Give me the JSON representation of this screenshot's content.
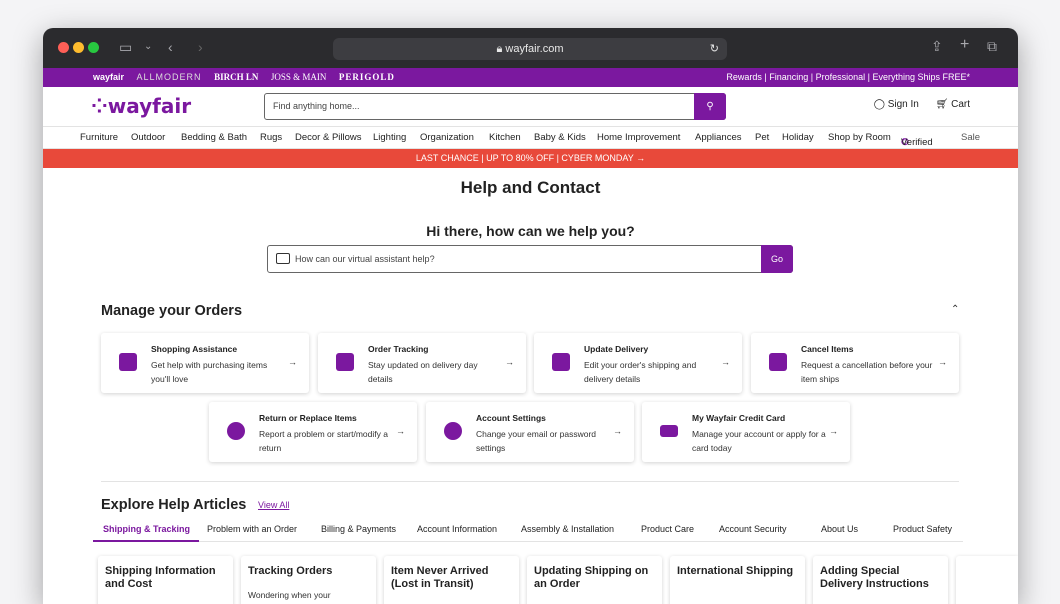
{
  "browser": {
    "url": "wayfair.com"
  },
  "promo": {
    "brands": [
      "wayfair",
      "ALLMODERN",
      "BIRCH LN",
      "JOSS & MAIN",
      "PERIGOLD"
    ],
    "links": "Rewards | Financing | Professional | Everything Ships FREE*"
  },
  "header": {
    "logo": "wayfair",
    "search_placeholder": "Find anything home...",
    "sign_in": "Sign In",
    "cart": "Cart"
  },
  "nav": [
    "Furniture",
    "Outdoor",
    "Bedding & Bath",
    "Rugs",
    "Decor & Pillows",
    "Lighting",
    "Organization",
    "Kitchen",
    "Baby & Kids",
    "Home Improvement",
    "Appliances",
    "Pet",
    "Holiday",
    "Shop by Room",
    "Verified",
    "Sale"
  ],
  "banner": "LAST CHANCE | UP TO 80% OFF | CYBER MONDAY →",
  "help": {
    "title": "Help and Contact",
    "greeting": "Hi there, how can we help you?",
    "assistant_placeholder": "How can our virtual assistant help?",
    "go": "Go"
  },
  "orders": {
    "title": "Manage your Orders",
    "cards": [
      {
        "title": "Shopping Assistance",
        "desc": "Get help with purchasing items you'll love"
      },
      {
        "title": "Order Tracking",
        "desc": "Stay updated on delivery day details"
      },
      {
        "title": "Update Delivery",
        "desc": "Edit your order's shipping and delivery details"
      },
      {
        "title": "Cancel Items",
        "desc": "Request a cancellation before your item ships"
      },
      {
        "title": "Return or Replace Items",
        "desc": "Report a problem or start/modify a return"
      },
      {
        "title": "Account Settings",
        "desc": "Change your email or password settings"
      },
      {
        "title": "My Wayfair Credit Card",
        "desc": "Manage your account or apply for a card today"
      }
    ]
  },
  "articles": {
    "title": "Explore Help Articles",
    "view_all": "View All",
    "tabs": [
      "Shipping & Tracking",
      "Problem with an Order",
      "Billing & Payments",
      "Account Information",
      "Assembly & Installation",
      "Product Care",
      "Account Security",
      "About Us",
      "Product Safety"
    ],
    "cards": [
      {
        "title": "Shipping Information and Cost",
        "desc": ""
      },
      {
        "title": "Tracking Orders",
        "desc": "Wondering when your"
      },
      {
        "title": "Item Never Arrived (Lost in Transit)",
        "desc": ""
      },
      {
        "title": "Updating Shipping on an Order",
        "desc": ""
      },
      {
        "title": "International Shipping",
        "desc": ""
      },
      {
        "title": "Adding Special Delivery Instructions",
        "desc": ""
      }
    ]
  },
  "colors": {
    "brand": "#7b189f",
    "banner": "#e8493a"
  }
}
